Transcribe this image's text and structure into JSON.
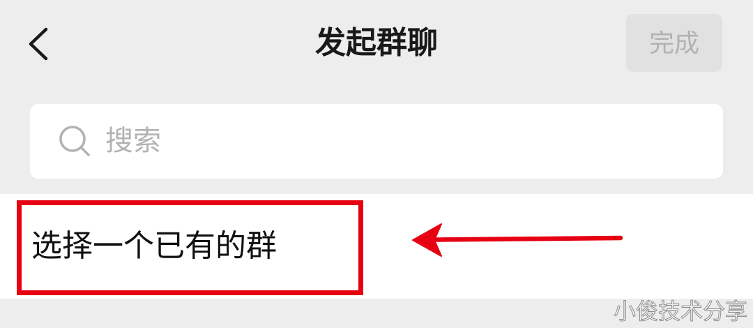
{
  "header": {
    "back_icon": "chevron-left-icon",
    "title": "发起群聊",
    "done_label": "完成",
    "done_enabled": false
  },
  "search": {
    "icon": "search-icon",
    "placeholder": "搜索",
    "value": ""
  },
  "list": {
    "items": [
      {
        "label": "选择一个已有的群"
      }
    ]
  },
  "annotations": {
    "arrow_icon": "arrow-left-icon",
    "color": "#e60012"
  },
  "watermark": "小俊技术分享",
  "colors": {
    "background": "#ededed",
    "surface": "#ffffff",
    "text": "#191919",
    "placeholder": "#b2b2b2",
    "done_button_bg": "#e1e1e1",
    "done_button_text": "#b2b2b2"
  }
}
